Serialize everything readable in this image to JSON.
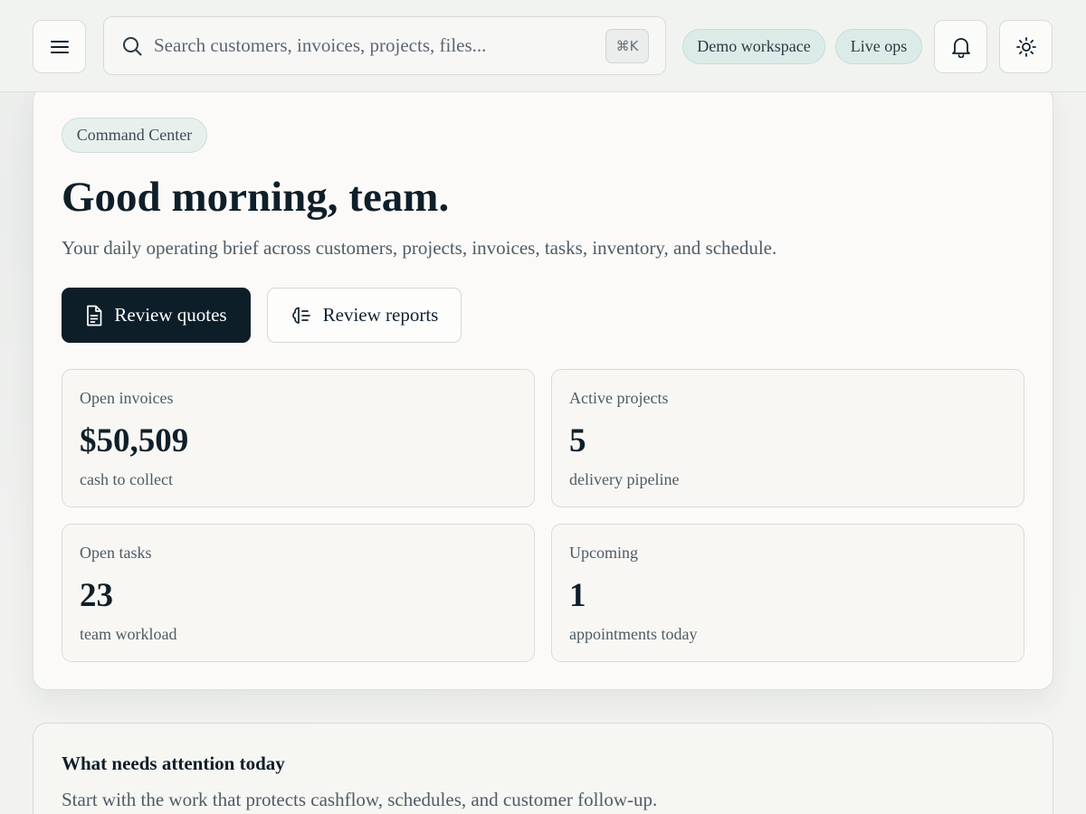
{
  "topbar": {
    "menu_icon": "hamburger-menu-icon",
    "search": {
      "placeholder": "Search customers, invoices, projects, files...",
      "value": "",
      "shortcut": "⌘K"
    },
    "pills": {
      "workspace": "Demo workspace",
      "mode": "Live ops"
    },
    "notification_icon": "bell-icon",
    "theme_icon": "sun-icon"
  },
  "hero": {
    "badge": "Command Center",
    "title": "Good morning, team.",
    "subtitle": "Your daily operating brief across customers, projects, invoices, tasks, inventory, and schedule.",
    "primary_button": {
      "label": "Review quotes",
      "icon": "document-icon"
    },
    "secondary_button": {
      "label": "Review reports",
      "icon": "reports-icon"
    },
    "stats": [
      {
        "label": "Open invoices",
        "value": "$50,509",
        "note": "cash to collect"
      },
      {
        "label": "Active projects",
        "value": "5",
        "note": "delivery pipeline"
      },
      {
        "label": "Open tasks",
        "value": "23",
        "note": "team workload"
      },
      {
        "label": "Upcoming",
        "value": "1",
        "note": "appointments today"
      }
    ]
  },
  "attention": {
    "title": "What needs attention today",
    "subtitle": "Start with the work that protects cashflow, schedules, and customer follow-up."
  },
  "colors": {
    "primary": "#0d1e29",
    "pill_bg": "#dbece8",
    "card_bg": "#fbfaf8",
    "page_bg": "#eef0ee"
  }
}
